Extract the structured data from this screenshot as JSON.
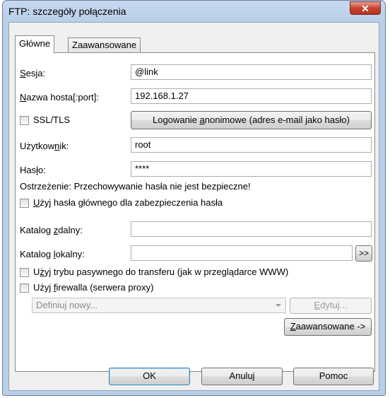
{
  "window": {
    "title": "FTP: szczegóły połączenia",
    "close_glyph": "✕"
  },
  "tabs": [
    {
      "label": "Główne",
      "active": true
    },
    {
      "label": "Zaawansowane",
      "active": false
    }
  ],
  "fields": {
    "session": {
      "label_pre": "",
      "label_u": "S",
      "label_post": "esja:",
      "value": "@link"
    },
    "host": {
      "label_pre": "",
      "label_u": "N",
      "label_post": "azwa hosta[:port]:",
      "value": "192.168.1.27"
    },
    "user": {
      "label_pre": "Użytkow",
      "label_u": "n",
      "label_post": "ik:",
      "value": "root"
    },
    "password": {
      "label_pre": "Has",
      "label_u": "ł",
      "label_post": "o:",
      "value": "****"
    },
    "remote_dir": {
      "label_pre": "Katalog ",
      "label_u": "z",
      "label_post": "dalny:",
      "value": ""
    },
    "local_dir": {
      "label_pre": "Katalog ",
      "label_u": "l",
      "label_post": "okalny:",
      "value": ""
    }
  },
  "ssl": {
    "label": "SSL/TLS",
    "checked": false
  },
  "anon_button": {
    "pre": "Logowanie ",
    "u": "a",
    "post": "nonimowe (adres e-mail jako hasło)"
  },
  "warning": "Ostrzeżenie: Przechowywanie hasła nie jest bezpieczne!",
  "master_password": {
    "pre": "",
    "u": "U",
    "post": "żyj hasła głównego dla zabezpieczenia hasła",
    "checked": false
  },
  "browse_button": ">>",
  "passive": {
    "pre": "U",
    "u": "ż",
    "post": "yj trybu pasywnego do transferu (jak w przeglądarce WWW)",
    "checked": false
  },
  "firewall": {
    "pre": "Użyj ",
    "u": "f",
    "post": "irewalla (serwera proxy)",
    "checked": false
  },
  "proxy_select": {
    "value": "Definiuj nowy..."
  },
  "edit_button": {
    "pre": "",
    "u": "E",
    "post": "dytuj..."
  },
  "advanced_button": {
    "pre": "",
    "u": "Z",
    "post": "aawansowane ->"
  },
  "footer": {
    "ok": "OK",
    "cancel": "Anuluj",
    "help": "Pomoc"
  }
}
